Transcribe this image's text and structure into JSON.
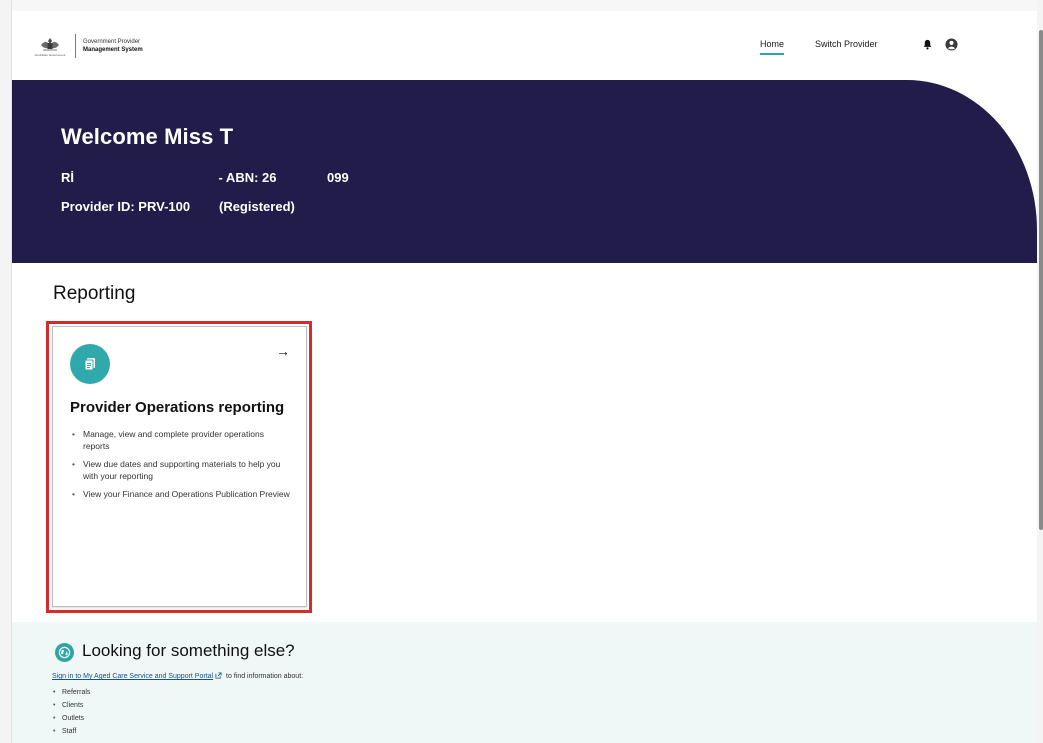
{
  "header": {
    "logo": {
      "caption": "Australian Government",
      "line1": "Government Provider",
      "line2": "Management System"
    },
    "nav": {
      "home": "Home",
      "switch_provider": "Switch Provider"
    }
  },
  "hero": {
    "title": "Welcome Miss T",
    "abn_line": "Rİ                                        - ABN: 26              099",
    "provider_line": "Provider ID: PRV-100        (Registered)"
  },
  "reporting": {
    "section_title": "Reporting",
    "card": {
      "arrow": "→",
      "title": "Provider Operations reporting",
      "bullets": [
        "Manage, view and complete provider operations reports",
        "View due dates and supporting materials to help you with your reporting",
        "View your Finance and Operations Publication Preview"
      ]
    }
  },
  "looking": {
    "title": "Looking for something else?",
    "link_text": "Sign in to My Aged Care Service and Support Portal",
    "suffix": " to find information about:",
    "items": [
      "Referrals",
      "Clients",
      "Outlets",
      "Staff"
    ]
  },
  "colors": {
    "hero_bg": "#211c4a",
    "accent_teal": "#30a9ad",
    "highlight_red": "#d62b2b",
    "bottom_bg": "#eff8f7"
  },
  "icons": {
    "card_icon": "document-copy-icon",
    "bottom_icon": "globe-icon",
    "bell": "bell-icon",
    "user": "user-circle-icon",
    "external": "external-link-icon"
  }
}
